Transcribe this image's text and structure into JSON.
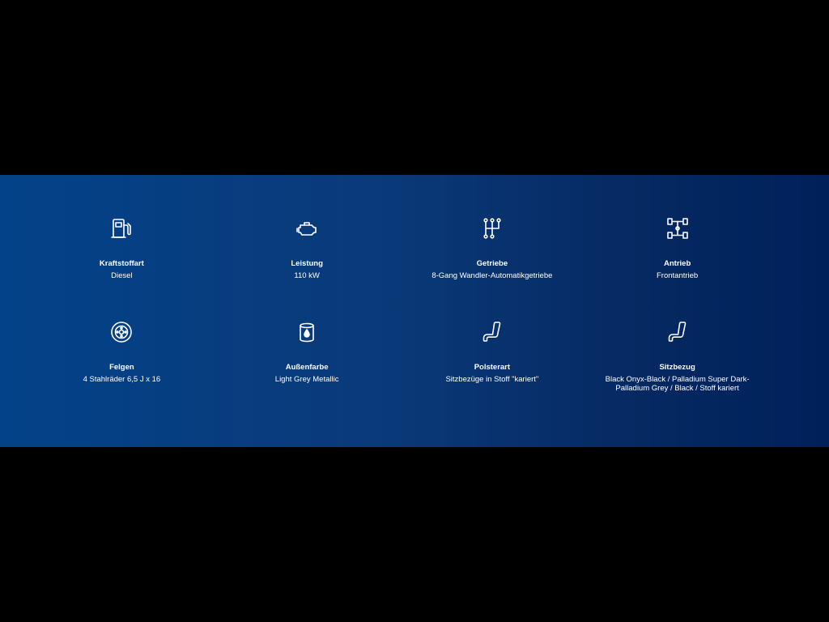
{
  "colors": {
    "background": "#000000",
    "band_start": "#034288",
    "band_end": "#00205a",
    "text": "#ffffff"
  },
  "specs": [
    {
      "icon": "fuel-pump-icon",
      "label": "Kraftstoffart",
      "value": "Diesel"
    },
    {
      "icon": "engine-icon",
      "label": "Leistung",
      "value": "110 kW"
    },
    {
      "icon": "gear-shift-icon",
      "label": "Getriebe",
      "value": "8-Gang Wandler-Automatikgetriebe"
    },
    {
      "icon": "drivetrain-icon",
      "label": "Antrieb",
      "value": "Frontantrieb"
    },
    {
      "icon": "wheel-rim-icon",
      "label": "Felgen",
      "value": "4 Stahlräder 6,5 J x 16"
    },
    {
      "icon": "paint-can-icon",
      "label": "Außenfarbe",
      "value": "Light Grey Metallic"
    },
    {
      "icon": "seat-icon",
      "label": "Polsterart",
      "value": "Sitzbezüge in Stoff \"kariert\""
    },
    {
      "icon": "seat-icon",
      "label": "Sitzbezug",
      "value": "Black Onyx-Black / Palladium Super Dark-Palladium Grey / Black / Stoff kariert"
    }
  ]
}
